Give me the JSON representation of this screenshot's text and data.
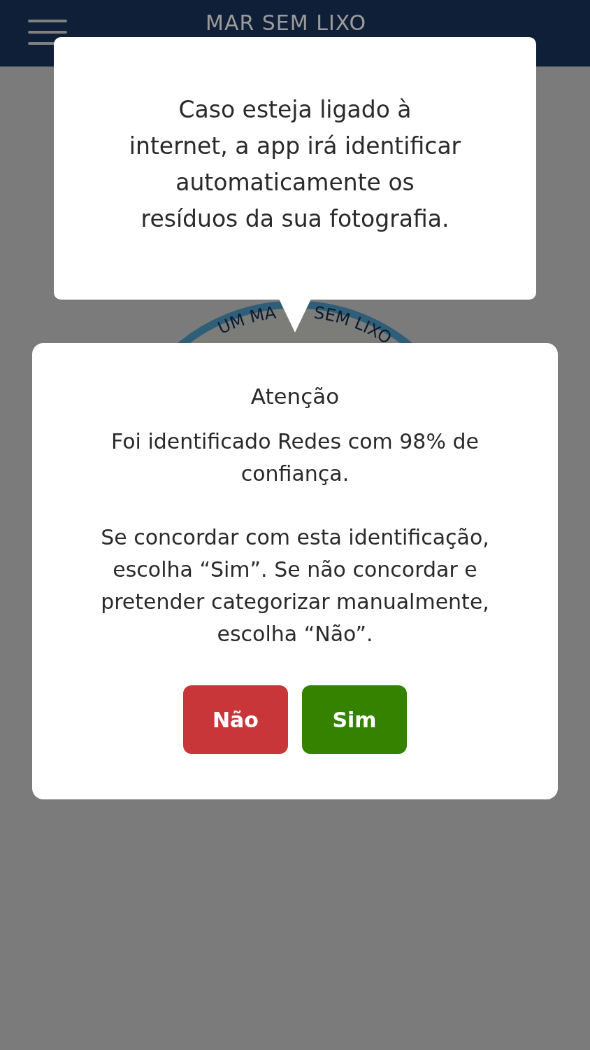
{
  "header": {
    "title": "MAR SEM LIXO"
  },
  "logo": {
    "text_left": "UM MA",
    "text_right": "SEM LIXO"
  },
  "tooltip": {
    "lines": [
      "Caso esteja ligado à",
      "internet, a app irá identificar",
      "automaticamente os",
      "resíduos da sua fotografia."
    ]
  },
  "dialog": {
    "title": "Atenção",
    "paragraphs": [
      "Foi identificado Redes com 98% de confiança.",
      "Se concordar com esta identificação, escolha “Sim”. Se não concordar e pretender categorizar manualmente, escolha “Não”."
    ],
    "buttons": [
      {
        "label": "Não",
        "kind": "reject"
      },
      {
        "label": "Sim",
        "kind": "accept"
      }
    ]
  }
}
